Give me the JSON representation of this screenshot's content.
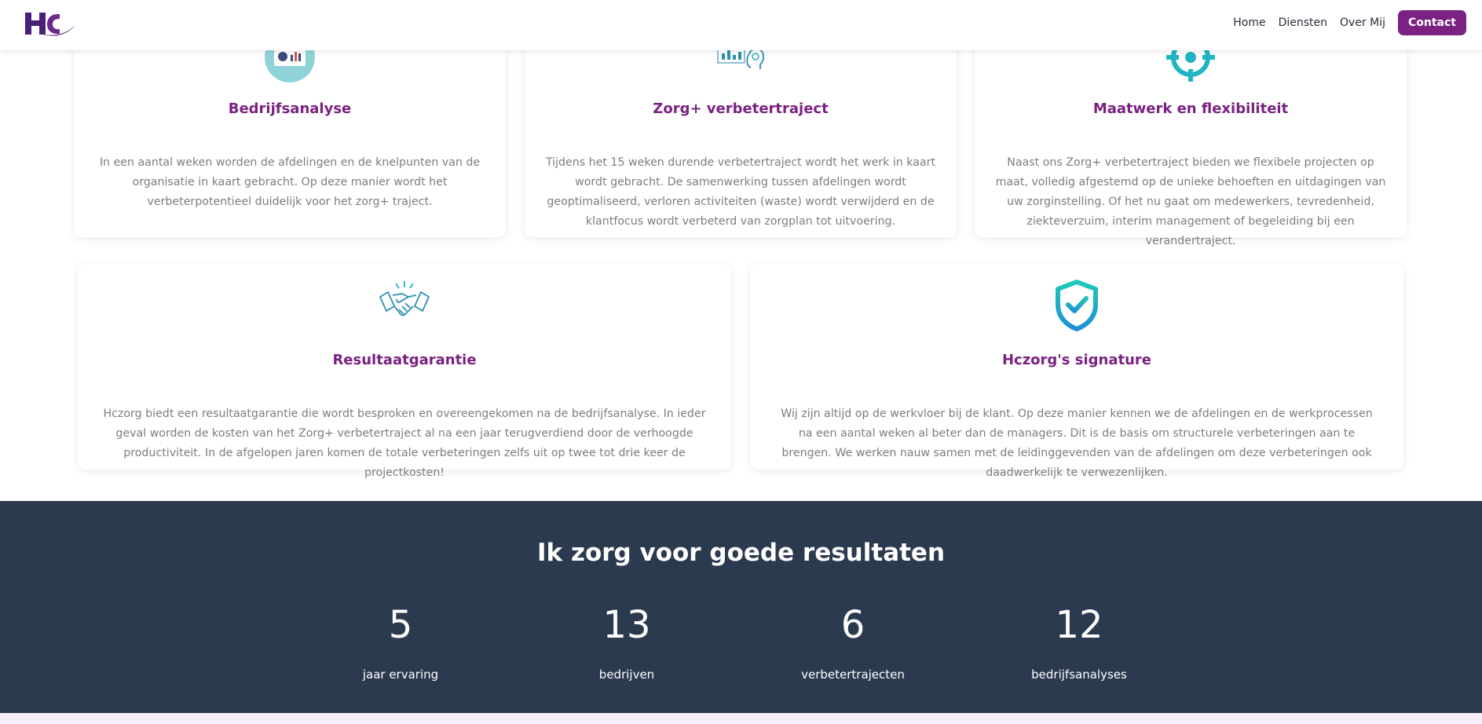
{
  "nav": {
    "home": "Home",
    "diensten": "Diensten",
    "over_mij": "Over Mij",
    "contact": "Contact"
  },
  "cards": [
    {
      "title": "Bedrijfsanalyse",
      "text": "In een aantal weken worden de afdelingen en de knelpunten van de organisatie in kaart gebracht. Op deze manier wordt het verbeterpotentieel duidelijk voor het zorg+ traject.",
      "icon": "analysis-dashboard-icon"
    },
    {
      "title": "Zorg+ verbetertraject",
      "text": "Tijdens het 15 weken durende verbetertraject wordt het werk in kaart wordt gebracht. De samenwerking tussen afdelingen wordt geoptimaliseerd, verloren activiteiten (waste) wordt verwijderd en de klantfocus wordt verbeterd van zorgplan tot uitvoering.",
      "icon": "chart-head-icon"
    },
    {
      "title": "Maatwerk en flexibiliteit",
      "text": "Naast ons Zorg+ verbetertraject bieden we flexibele projecten op maat, volledig afgestemd op de unieke behoeften en uitdagingen van uw zorginstelling. Of het nu gaat om medewerkers, tevredenheid, ziekteverzuim, interim management of begeleiding bij een verandertraject.",
      "icon": "target-icon"
    },
    {
      "title": "Resultaatgarantie",
      "text": "Hczorg biedt een resultaatgarantie die wordt besproken en overeengekomen na de bedrijfsanalyse. In ieder geval worden de kosten van het Zorg+ verbetertraject al na een jaar terugverdiend door de verhoogde productiviteit. In de afgelopen jaren komen de totale verbeteringen zelfs uit op twee tot drie keer de projectkosten!",
      "icon": "handshake-icon"
    },
    {
      "title": "Hczorg's signature",
      "text": "Wij zijn altijd op de werkvloer bij de klant. Op deze manier kennen we de afdelingen en de werkprocessen na een aantal weken al beter dan de managers. Dit is de basis om structurele verbeteringen aan te brengen. We werken nauw samen met de leidinggevenden van de afdelingen om deze verbeteringen ook daadwerkelijk te verwezenlijken.",
      "icon": "shield-check-icon"
    }
  ],
  "stats": {
    "title": "Ik zorg voor goede resultaten",
    "items": [
      {
        "value": "5",
        "label": "jaar ervaring"
      },
      {
        "value": "13",
        "label": "bedrijven"
      },
      {
        "value": "6",
        "label": "verbetertrajecten"
      },
      {
        "value": "12",
        "label": "bedrijfsanalyses"
      }
    ]
  },
  "colors": {
    "brand_purple": "#7a2181",
    "stats_bg": "#2c3a4f",
    "teal": "#1fb5c2"
  }
}
